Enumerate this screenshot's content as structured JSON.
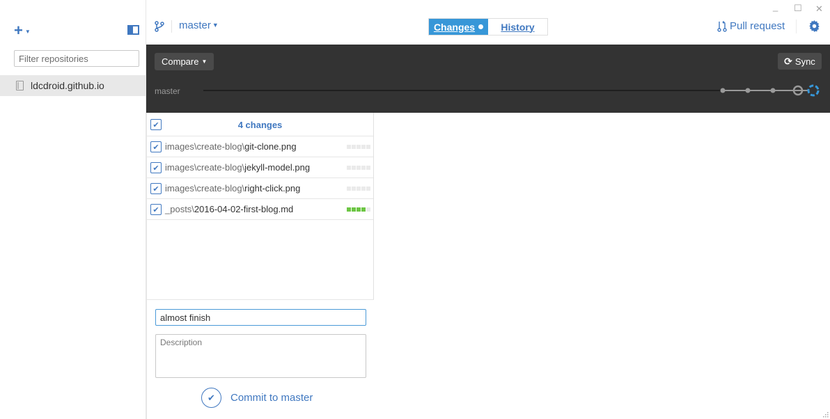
{
  "sidebar": {
    "add_icon": "plus-icon",
    "filter_placeholder": "Filter repositories",
    "repositories": [
      {
        "name": "ldcdroid.github.io",
        "icon": "repo-icon",
        "selected": true
      }
    ]
  },
  "header": {
    "branch": "master",
    "tabs": [
      {
        "label": "Changes",
        "active": true,
        "has_indicator": true
      },
      {
        "label": "History",
        "active": false
      }
    ],
    "pull_request_label": "Pull request",
    "window_controls": {
      "minimize": "_",
      "maximize": "☐",
      "close": "✕"
    }
  },
  "toolbar": {
    "compare_label": "Compare",
    "sync_label": "Sync",
    "timeline_branch": "master"
  },
  "changes": {
    "count_label": "4 changes",
    "all_checked": true,
    "files": [
      {
        "dir": "images\\create-blog\\",
        "name": "git-clone.png",
        "checked": true,
        "added_blocks": 0
      },
      {
        "dir": "images\\create-blog\\",
        "name": "jekyll-model.png",
        "checked": true,
        "added_blocks": 0
      },
      {
        "dir": "images\\create-blog\\",
        "name": "right-click.png",
        "checked": true,
        "added_blocks": 0
      },
      {
        "dir": "_posts\\",
        "name": "2016-04-02-first-blog.md",
        "checked": true,
        "added_blocks": 4
      }
    ]
  },
  "commit": {
    "summary_value": "almost finish",
    "description_placeholder": "Description",
    "button_label": "Commit to master"
  },
  "colors": {
    "accent": "#4078c0",
    "active_tab": "#3797d8",
    "dark_bar": "#333333",
    "diff_added": "#6cc644"
  }
}
